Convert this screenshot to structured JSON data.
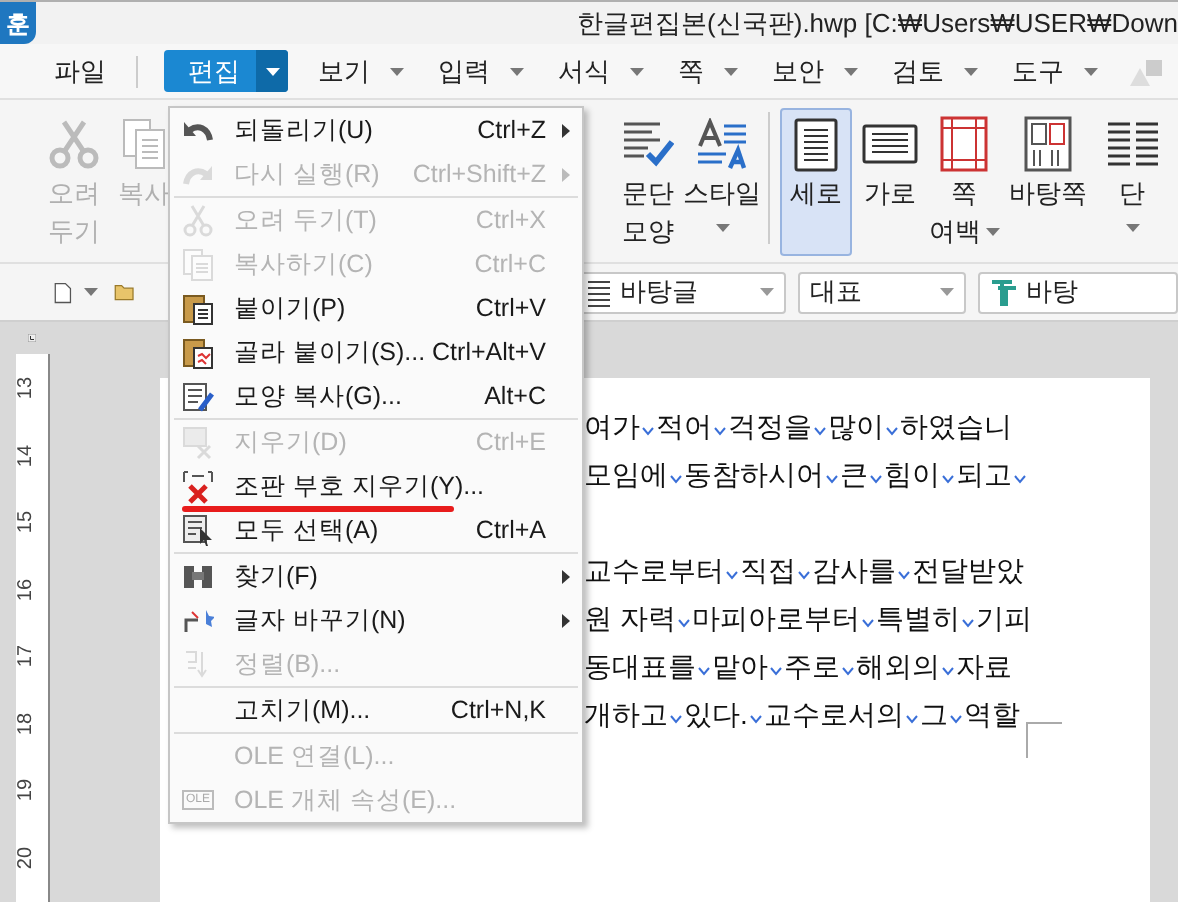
{
  "window": {
    "logo_text": "훈",
    "title": "한글편집본(신국판).hwp [C:₩Users₩USER₩Down"
  },
  "menu_bar": [
    {
      "label": "파일",
      "selected": false,
      "has_caret": false
    },
    {
      "label": "편집",
      "selected": true,
      "has_caret": true
    },
    {
      "label": "보기",
      "selected": false,
      "has_caret": true
    },
    {
      "label": "입력",
      "selected": false,
      "has_caret": true
    },
    {
      "label": "서식",
      "selected": false,
      "has_caret": true
    },
    {
      "label": "쪽",
      "selected": false,
      "has_caret": true
    },
    {
      "label": "보안",
      "selected": false,
      "has_caret": true
    },
    {
      "label": "검토",
      "selected": false,
      "has_caret": true
    },
    {
      "label": "도구",
      "selected": false,
      "has_caret": true
    }
  ],
  "ribbon": {
    "left": [
      {
        "label_lines": [
          "오려",
          "두기"
        ],
        "disabled": true,
        "selected": false,
        "has_caret": false
      },
      {
        "label_lines": [
          "복사"
        ],
        "disabled": true,
        "selected": false,
        "has_caret": false
      }
    ],
    "right": [
      {
        "label_lines": [
          "문단",
          "모양"
        ],
        "disabled": false,
        "selected": false,
        "has_caret": false
      },
      {
        "label_lines": [
          "스타일"
        ],
        "disabled": false,
        "selected": false,
        "has_caret": true
      },
      {
        "label_lines": [
          "세로"
        ],
        "disabled": false,
        "selected": true,
        "has_caret": false
      },
      {
        "label_lines": [
          "가로"
        ],
        "disabled": false,
        "selected": false,
        "has_caret": false
      },
      {
        "label_lines": [
          "쪽",
          "여백"
        ],
        "disabled": false,
        "selected": false,
        "has_caret": true
      },
      {
        "label_lines": [
          "바탕쪽"
        ],
        "disabled": false,
        "selected": false,
        "has_caret": false
      },
      {
        "label_lines": [
          "단"
        ],
        "disabled": false,
        "selected": false,
        "has_caret": true
      }
    ]
  },
  "toolbar": {
    "combos": [
      {
        "value": "바탕글"
      },
      {
        "value": "대표"
      },
      {
        "value": "바탕"
      }
    ]
  },
  "ruler": {
    "labels": [
      "13",
      "14",
      "15",
      "16",
      "17",
      "18",
      "19",
      "20"
    ]
  },
  "document": {
    "lines": [
      {
        "kind": "text",
        "words": [
          "여가",
          "적어",
          "걱정을",
          "많이",
          "하였습니"
        ],
        "trailing_mark": false
      },
      {
        "kind": "text",
        "words": [
          "모임에",
          "동참하시어",
          "큰",
          "힘이",
          "되고"
        ],
        "trailing_mark": true
      },
      {
        "kind": "blank"
      },
      {
        "kind": "text",
        "words": [
          "교수로부터",
          "직접",
          "감사를",
          "전달받았"
        ],
        "trailing_mark": false
      },
      {
        "kind": "text",
        "words": [
          "원 자력",
          "마피아로부터",
          "특별히",
          "기피"
        ],
        "trailing_mark": false
      },
      {
        "kind": "text",
        "words": [
          "동대표를",
          "맡아",
          "주로",
          "해외의",
          "자료"
        ],
        "trailing_mark": false
      },
      {
        "kind": "text",
        "words": [
          "개하고",
          "있다.",
          "교수로서의",
          "그",
          "역할"
        ],
        "trailing_mark": false
      }
    ]
  },
  "edit_menu": [
    {
      "kind": "command",
      "label": "되돌리기(U)",
      "shortcut": "Ctrl+Z",
      "disabled": false,
      "submenu": true,
      "underlined": false
    },
    {
      "kind": "command",
      "label": "다시 실행(R)",
      "shortcut": "Ctrl+Shift+Z",
      "disabled": true,
      "submenu": true,
      "underlined": false
    },
    {
      "kind": "separator"
    },
    {
      "kind": "command",
      "label": "오려 두기(T)",
      "shortcut": "Ctrl+X",
      "disabled": true,
      "submenu": false,
      "underlined": false
    },
    {
      "kind": "command",
      "label": "복사하기(C)",
      "shortcut": "Ctrl+C",
      "disabled": true,
      "submenu": false,
      "underlined": false
    },
    {
      "kind": "command",
      "label": "붙이기(P)",
      "shortcut": "Ctrl+V",
      "disabled": false,
      "submenu": false,
      "underlined": false
    },
    {
      "kind": "command",
      "label": "골라 붙이기(S)...",
      "shortcut": "Ctrl+Alt+V",
      "disabled": false,
      "submenu": false,
      "underlined": false
    },
    {
      "kind": "command",
      "label": "모양 복사(G)...",
      "shortcut": "Alt+C",
      "disabled": false,
      "submenu": false,
      "underlined": false
    },
    {
      "kind": "separator"
    },
    {
      "kind": "command",
      "label": "지우기(D)",
      "shortcut": "Ctrl+E",
      "disabled": true,
      "submenu": false,
      "underlined": false
    },
    {
      "kind": "command",
      "label": "조판 부호 지우기(Y)...",
      "disabled": false,
      "submenu": false,
      "underlined": true
    },
    {
      "kind": "command",
      "label": "모두 선택(A)",
      "shortcut": "Ctrl+A",
      "disabled": false,
      "submenu": false,
      "underlined": false
    },
    {
      "kind": "separator"
    },
    {
      "kind": "command",
      "label": "찾기(F)",
      "disabled": false,
      "submenu": true,
      "underlined": false
    },
    {
      "kind": "command",
      "label": "글자 바꾸기(N)",
      "disabled": false,
      "submenu": true,
      "underlined": false
    },
    {
      "kind": "command",
      "label": "정렬(B)...",
      "disabled": true,
      "submenu": false,
      "underlined": false
    },
    {
      "kind": "separator"
    },
    {
      "kind": "command",
      "label": "고치기(M)...",
      "shortcut": "Ctrl+N,K",
      "disabled": false,
      "submenu": false,
      "underlined": false
    },
    {
      "kind": "separator"
    },
    {
      "kind": "command",
      "label": "OLE 연결(L)...",
      "disabled": true,
      "submenu": false,
      "underlined": false
    },
    {
      "kind": "command",
      "label": "OLE 개체 속성(E)...",
      "icon_text": "OLE",
      "disabled": true,
      "submenu": false,
      "underlined": false
    }
  ]
}
